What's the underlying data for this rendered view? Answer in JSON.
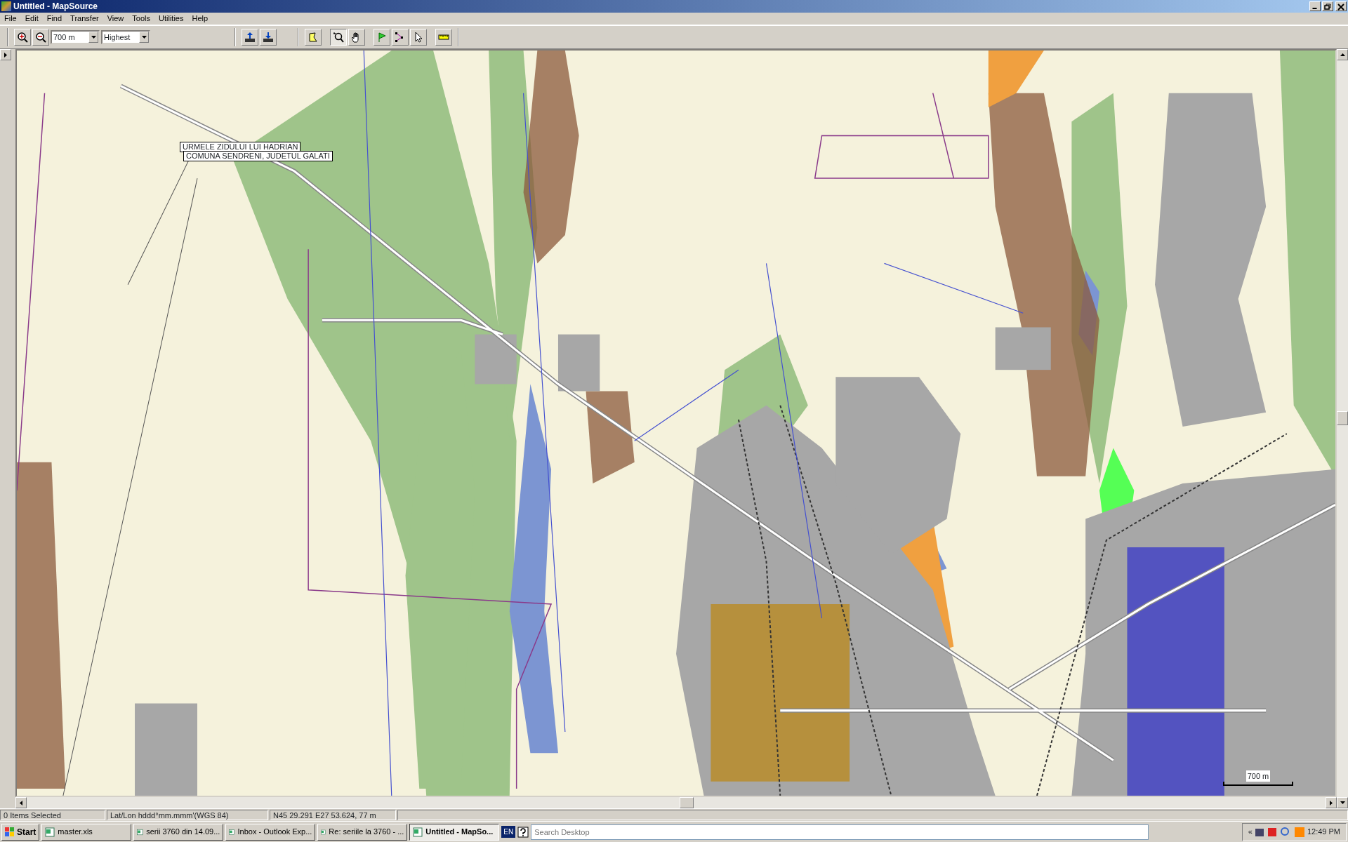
{
  "window": {
    "title": "Untitled - MapSource"
  },
  "menu": [
    "File",
    "Edit",
    "Find",
    "Transfer",
    "View",
    "Tools",
    "Utilities",
    "Help"
  ],
  "toolbar": {
    "zoom_buttons": [
      {
        "kind": "zoom-in"
      },
      {
        "kind": "zoom-out"
      }
    ],
    "scale_select": {
      "value": "700 m"
    },
    "detail_select": {
      "value": "Highest"
    },
    "transfer_buttons": [
      {
        "kind": "send"
      },
      {
        "kind": "receive"
      }
    ],
    "tools": [
      {
        "kind": "area",
        "selected": false
      },
      {
        "kind": "zoom",
        "selected": true
      },
      {
        "kind": "pan",
        "selected": false
      },
      {
        "kind": "waypoint",
        "selected": false
      },
      {
        "kind": "route",
        "selected": false
      },
      {
        "kind": "select",
        "selected": false
      },
      {
        "kind": "measure",
        "selected": false
      }
    ]
  },
  "map": {
    "tooltip": [
      "URMELE ZIDULUI LUI HADRIAN",
      "COMUNA SENDRENI, JUDETUL GALATI"
    ],
    "scale": "700 m"
  },
  "status_bar": [
    "0 Items Selected",
    "Lat/Lon hddd°mm.mmm'(WGS 84)",
    "N45 29.291 E27 53.624, 77 m"
  ],
  "taskbar": {
    "start": "Start",
    "tasks": [
      {
        "label": "master.xls",
        "selected": false
      },
      {
        "label": "serii 3760 din 14.09...",
        "selected": false
      },
      {
        "label": "Inbox - Outlook Exp...",
        "selected": false
      },
      {
        "label": "Re: seriile la 3760 - ...",
        "selected": false
      },
      {
        "label": "Untitled - MapSo...",
        "selected": true
      }
    ],
    "language": "EN",
    "search": {
      "placeholder": "Search Desktop"
    },
    "tray_toggle": "«",
    "clock": "12:49 PM"
  }
}
